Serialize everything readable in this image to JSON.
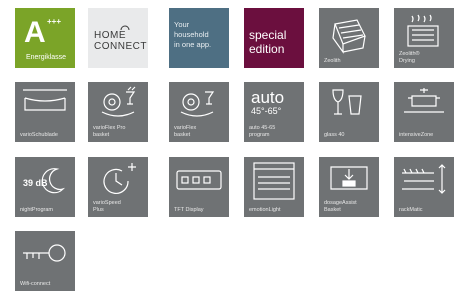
{
  "tiles": {
    "energy": {
      "grade": "A",
      "plus": "+++",
      "label": "Energiklasse"
    },
    "home_connect": {
      "line1": "HOME",
      "line2": "CONNECT"
    },
    "household": {
      "text": "Your\nhousehold\nin one app."
    },
    "special": {
      "text": "special\nedition"
    },
    "zeolith": {
      "caption": "Zeolith"
    },
    "zeolith_drying": {
      "caption": "Zeolith®\nDrying"
    },
    "vario_drawer": {
      "caption": "varioSchublade"
    },
    "varioflex_pro": {
      "caption": "varioFlex Pro\nbasket"
    },
    "varioflex": {
      "caption": "varioFlex\nbasket"
    },
    "auto_program": {
      "line1": "auto",
      "line2": "45°-65°",
      "caption": "auto 45-65\nprogram"
    },
    "glass40": {
      "caption": "glass 40"
    },
    "intensive_zone": {
      "caption": "intensiveZone"
    },
    "night_program": {
      "db": "39 dB",
      "caption": "nightProgram"
    },
    "variospeed": {
      "caption": "varioSpeed\nPlus"
    },
    "tft_display": {
      "caption": "TFT Display"
    },
    "emotion_light": {
      "caption": "emotionLight"
    },
    "dosage_assist": {
      "caption": "dosageAssist\nBasket"
    },
    "rackmatic": {
      "caption": "rackMatic"
    },
    "wifi_key": {
      "caption": "Wifi-connect"
    }
  },
  "colors": {
    "energy_green": "#7ba428",
    "tile_gray": "#6f7274",
    "home_connect_bg": "#e9eaeb",
    "household_blue": "#4e6f83",
    "special_plum": "#6b0f3e"
  }
}
